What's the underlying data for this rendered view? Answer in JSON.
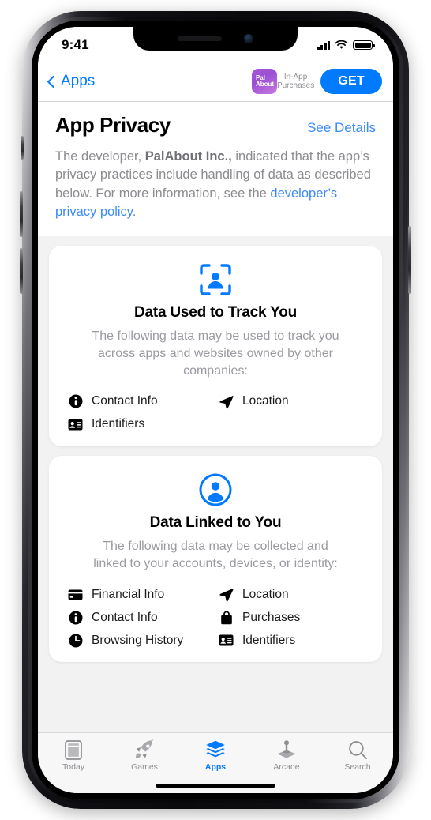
{
  "status_bar": {
    "time": "9:41",
    "signal_icon": "cellular-bars-icon",
    "wifi_icon": "wifi-icon",
    "battery_icon": "battery-full-icon"
  },
  "nav_bar": {
    "back_label": "Apps",
    "back_icon": "chevron-left-icon",
    "app_icon_name": "palabout-app-icon",
    "app_icon_line1": "Pal",
    "app_icon_line2": "About",
    "iap_line1": "In-App",
    "iap_line2": "Purchases",
    "get_label": "GET"
  },
  "header": {
    "title": "App Privacy",
    "see_details_label": "See Details",
    "desc_part1": "The developer, ",
    "desc_developer": "PalAbout Inc.,",
    "desc_part2": " indicated that the app’s privacy practices include handling of data as described below. For more information, see the ",
    "desc_link": "developer’s privacy policy",
    "desc_part3": "."
  },
  "cards": [
    {
      "icon": "person-viewfinder-icon",
      "title": "Data Used to Track You",
      "subtitle": "The following data may be used to track you across apps and websites owned by other companies:",
      "items": [
        {
          "label": "Contact Info",
          "icon": "info-circle-icon"
        },
        {
          "label": "Location",
          "icon": "location-arrow-icon"
        },
        {
          "label": "Identifiers",
          "icon": "id-card-icon"
        }
      ]
    },
    {
      "icon": "person-circle-icon",
      "title": "Data Linked to You",
      "subtitle": "The following data may be collected and linked to your accounts, devices, or identity:",
      "items": [
        {
          "label": "Financial Info",
          "icon": "credit-card-icon"
        },
        {
          "label": "Location",
          "icon": "location-arrow-icon"
        },
        {
          "label": "Contact Info",
          "icon": "info-circle-icon"
        },
        {
          "label": "Purchases",
          "icon": "shopping-bag-icon"
        },
        {
          "label": "Browsing History",
          "icon": "clock-icon"
        },
        {
          "label": "Identifiers",
          "icon": "id-card-icon"
        }
      ]
    }
  ],
  "tab_bar": {
    "tabs": [
      {
        "label": "Today",
        "icon": "today-page-icon",
        "active": false
      },
      {
        "label": "Games",
        "icon": "rocket-icon",
        "active": false
      },
      {
        "label": "Apps",
        "icon": "stacked-layers-icon",
        "active": true
      },
      {
        "label": "Arcade",
        "icon": "joystick-icon",
        "active": false
      },
      {
        "label": "Search",
        "icon": "magnifier-icon",
        "active": false
      }
    ]
  },
  "colors": {
    "accent_blue": "#007aff",
    "link_blue": "#3b8bfb",
    "muted_gray": "#8e8e93",
    "card_white": "#ffffff",
    "page_bg": "#f2f2f2",
    "app_icon_purple": "#a855d8"
  }
}
